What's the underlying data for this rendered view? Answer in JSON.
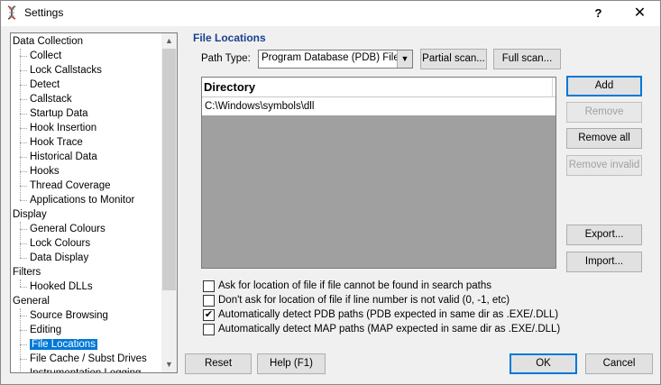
{
  "window": {
    "title": "Settings",
    "help_label": "?",
    "close_label": "✕"
  },
  "tree": {
    "items": [
      {
        "label": "Data Collection",
        "level": 0
      },
      {
        "label": "Collect",
        "level": 1
      },
      {
        "label": "Lock Callstacks",
        "level": 1
      },
      {
        "label": "Detect",
        "level": 1
      },
      {
        "label": "Callstack",
        "level": 1
      },
      {
        "label": "Startup Data",
        "level": 1
      },
      {
        "label": "Hook Insertion",
        "level": 1
      },
      {
        "label": "Hook Trace",
        "level": 1
      },
      {
        "label": "Historical Data",
        "level": 1
      },
      {
        "label": "Hooks",
        "level": 1
      },
      {
        "label": "Thread Coverage",
        "level": 1
      },
      {
        "label": "Applications to Monitor",
        "level": 1
      },
      {
        "label": "Display",
        "level": 0
      },
      {
        "label": "General Colours",
        "level": 1
      },
      {
        "label": "Lock Colours",
        "level": 1
      },
      {
        "label": "Data Display",
        "level": 1
      },
      {
        "label": "Filters",
        "level": 0
      },
      {
        "label": "Hooked DLLs",
        "level": 1
      },
      {
        "label": "General",
        "level": 0
      },
      {
        "label": "Source Browsing",
        "level": 1
      },
      {
        "label": "Editing",
        "level": 1
      },
      {
        "label": "File Locations",
        "level": 1,
        "selected": true
      },
      {
        "label": "File Cache / Subst Drives",
        "level": 1
      },
      {
        "label": "Instrumentation Logging",
        "level": 1
      }
    ]
  },
  "panel": {
    "title": "File Locations",
    "path_type_label": "Path Type:",
    "path_type_value": "Program Database (PDB) Files",
    "partial_scan_label": "Partial scan...",
    "full_scan_label": "Full scan...",
    "table": {
      "header": "Directory",
      "rows": [
        "C:\\Windows\\symbols\\dll"
      ]
    },
    "buttons": {
      "add": "Add",
      "remove": "Remove",
      "remove_all": "Remove all",
      "remove_invalid": "Remove invalid",
      "export": "Export...",
      "import": "Import..."
    },
    "options": [
      {
        "label": "Ask for location of file if file cannot be found in search paths",
        "checked": false
      },
      {
        "label": "Don't ask for location of file if line number is not valid (0, -1, etc)",
        "checked": false
      },
      {
        "label": "Automatically detect PDB paths (PDB expected in same dir as .EXE/.DLL)",
        "checked": true
      },
      {
        "label": "Automatically detect MAP paths (MAP expected in same dir as .EXE/.DLL)",
        "checked": false
      }
    ]
  },
  "footer": {
    "reset": "Reset",
    "help": "Help (F1)",
    "ok": "OK",
    "cancel": "Cancel"
  },
  "colors": {
    "selection": "#0078d7",
    "section_title": "#1a3f8f",
    "table_background": "#a0a0a0"
  }
}
